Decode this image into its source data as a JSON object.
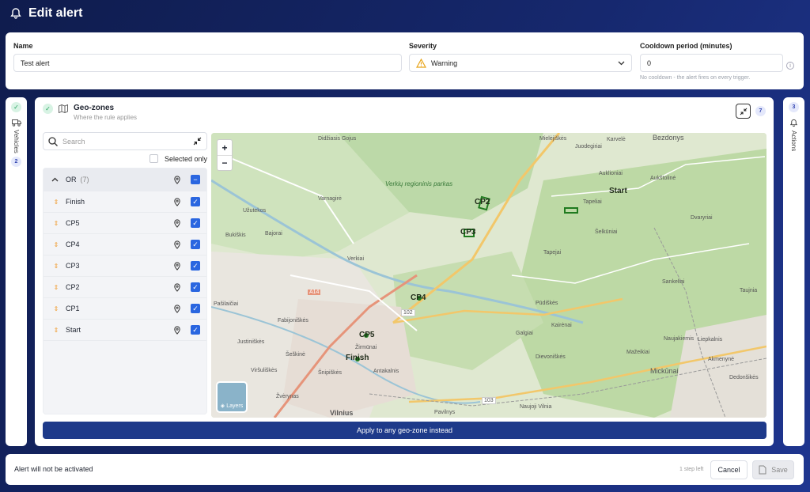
{
  "header": {
    "title": "Edit alert",
    "icon": "bell-icon"
  },
  "form": {
    "name": {
      "label": "Name",
      "value": "Test alert"
    },
    "severity": {
      "label": "Severity",
      "value": "Warning",
      "icon": "warning-icon"
    },
    "cooldown": {
      "label": "Cooldown period (minutes)",
      "value": "0",
      "help": "No cooldown - the alert fires on every trigger."
    }
  },
  "left_rail": {
    "label": "Vehicles",
    "count": "2"
  },
  "right_rail": {
    "label": "Actions",
    "count": "3"
  },
  "geozones": {
    "title": "Geo-zones",
    "subtitle": "Where the rule applies",
    "count": "7",
    "search_placeholder": "Search",
    "selected_only_label": "Selected only",
    "group": {
      "operator": "OR",
      "count": "(7)"
    },
    "items": [
      {
        "label": "Finish",
        "checked": true
      },
      {
        "label": "CP5",
        "checked": true
      },
      {
        "label": "CP4",
        "checked": true
      },
      {
        "label": "CP3",
        "checked": true
      },
      {
        "label": "CP2",
        "checked": true
      },
      {
        "label": "CP1",
        "checked": true
      },
      {
        "label": "Start",
        "checked": true
      }
    ],
    "apply_any_label": "Apply to any geo-zone instead"
  },
  "map": {
    "layers_label": "Layers",
    "zoom_in": "+",
    "zoom_out": "−",
    "places": [
      "Didžiasis Gojus",
      "Bezdonys",
      "Mielėjiškės",
      "Karvelė",
      "Juodegiriai",
      "Auklioniai",
      "Aukštolinė",
      "Tapeliai",
      "Šelkūniai",
      "Verkių regioninis parkas",
      "Varnagirė",
      "Užutekos",
      "Bajorai",
      "Verkiai",
      "Sankeliai",
      "Taujnia",
      "Fabijoniškės",
      "Justiniškės",
      "Šeškinė",
      "Viršuliškės",
      "Šnipiškės",
      "Žirmūnai",
      "Antakalnis",
      "Kairėnai",
      "Galgiai",
      "Dievoniškės",
      "Naujakiemis",
      "Mickūnai",
      "Pūdiškės",
      "Vilnius",
      "Žvėrynas",
      "Naujoji Vilnia",
      "Pavilnys",
      "Mažeikiai",
      "Pašilaičiai",
      "Bukiškis",
      "Dvaryriai",
      "Liepkalnis",
      "Tapejai",
      "Akmenynė",
      "Dedonšikės"
    ],
    "zones": [
      "Finish",
      "CP5",
      "CP4",
      "CP3",
      "CP2",
      "Start"
    ],
    "roads": [
      "A14",
      "102",
      "103"
    ]
  },
  "footer": {
    "status": "Alert will not be activated",
    "steps_left": "1 step left",
    "cancel_label": "Cancel",
    "save_label": "Save"
  },
  "colors": {
    "accent": "#1e3a8a",
    "checkbox": "#2a66e0",
    "background": "#16286e",
    "zone": "#1f7a1f"
  }
}
